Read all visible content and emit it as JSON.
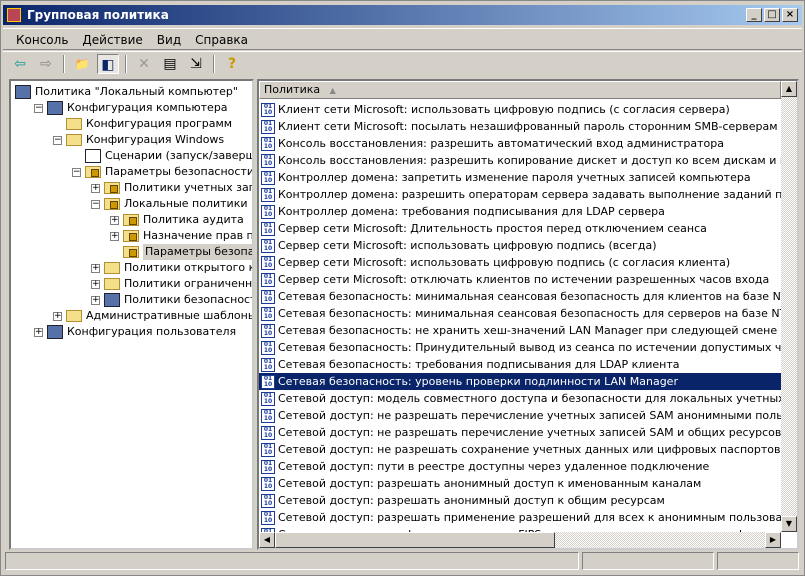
{
  "window": {
    "title": "Групповая политика",
    "controls": [
      "_",
      "□",
      "×"
    ]
  },
  "menu": [
    "Консоль",
    "Действие",
    "Вид",
    "Справка"
  ],
  "toolbar": [
    {
      "icon": "back-arrow-icon",
      "glyph": "⇦"
    },
    {
      "icon": "forward-arrow-icon",
      "glyph": "⇨"
    },
    {
      "icon": "up-folder-icon",
      "glyph": "📁"
    },
    {
      "icon": "show-hide-tree-icon",
      "glyph": "◧"
    },
    {
      "icon": "delete-icon",
      "glyph": "✕"
    },
    {
      "icon": "properties-icon",
      "glyph": "▤"
    },
    {
      "icon": "export-list-icon",
      "glyph": "⇲"
    },
    {
      "icon": "help-icon",
      "glyph": "?"
    }
  ],
  "tree": [
    {
      "label": "Политика \"Локальный компьютер\"",
      "level": 0,
      "icon": "policy",
      "toggle": ""
    },
    {
      "label": "Конфигурация компьютера",
      "level": 1,
      "icon": "computer",
      "toggle": "-"
    },
    {
      "label": "Конфигурация программ",
      "level": 2,
      "icon": "folder",
      "toggle": ""
    },
    {
      "label": "Конфигурация Windows",
      "level": 2,
      "icon": "folder",
      "toggle": "-"
    },
    {
      "label": "Сценарии (запуск/завершение)",
      "level": 3,
      "icon": "script",
      "toggle": ""
    },
    {
      "label": "Параметры безопасности",
      "level": 3,
      "icon": "lockfolder",
      "toggle": "-"
    },
    {
      "label": "Политики учетных записей",
      "level": 4,
      "icon": "lockfolder",
      "toggle": "+"
    },
    {
      "label": "Локальные политики",
      "level": 4,
      "icon": "lockfolder",
      "toggle": "-"
    },
    {
      "label": "Политика аудита",
      "level": 5,
      "icon": "lockfolder",
      "toggle": "+"
    },
    {
      "label": "Назначение прав пользователя",
      "level": 5,
      "icon": "lockfolder",
      "toggle": "+"
    },
    {
      "label": "Параметры безопасности",
      "level": 5,
      "icon": "lockfolder",
      "toggle": "",
      "selected": true
    },
    {
      "label": "Политики открытого ключа",
      "level": 4,
      "icon": "folder",
      "toggle": "+"
    },
    {
      "label": "Политики ограниченного использования программ",
      "level": 4,
      "icon": "folder",
      "toggle": "+"
    },
    {
      "label": "Политики безопасности IP на \"Локальный компьютер\"",
      "level": 4,
      "icon": "computer",
      "toggle": "+"
    },
    {
      "label": "Административные шаблоны",
      "level": 2,
      "icon": "folder",
      "toggle": "+"
    },
    {
      "label": "Конфигурация пользователя",
      "level": 1,
      "icon": "user",
      "toggle": "+"
    }
  ],
  "list": {
    "column": "Политика",
    "sort_indicator": "▲",
    "selected_index": 16,
    "rows": [
      "Клиент сети Microsoft: использовать цифровую подпись (с согласия сервера)",
      "Клиент сети Microsoft: посылать незашифрованный пароль сторонним SMB-серверам",
      "Консоль восстановления: разрешить автоматический вход администратора",
      "Консоль восстановления: разрешить копирование дискет и доступ ко всем дискам и папкам",
      "Контроллер домена: запретить изменение пароля учетных записей компьютера",
      "Контроллер домена: разрешить операторам сервера задавать выполнение заданий по расписанию",
      "Контроллер домена: требования подписывания для LDAP сервера",
      "Сервер сети Microsoft: Длительность простоя перед отключением сеанса",
      "Сервер сети Microsoft: использовать цифровую подпись (всегда)",
      "Сервер сети Microsoft: использовать цифровую подпись (с согласия клиента)",
      "Сервер сети Microsoft: отключать клиентов по истечении разрешенных часов входа",
      "Сетевая безопасность: минимальная сеансовая безопасность для клиентов на базе NTLM SSP (включая безопасный RPC)",
      "Сетевая безопасность: минимальная сеансовая безопасность для серверов на базе NTLM SSP (включая безопасный RPC)",
      "Сетевая безопасность: не хранить хеш-значений LAN Manager при следующей смене пароля",
      "Сетевая безопасность: Принудительный вывод из сеанса по истечении допустимых часов работы",
      "Сетевая безопасность: требования подписывания для LDAP клиента",
      "Сетевая безопасность: уровень проверки подлинности LAN Manager",
      "Сетевой доступ: модель совместного доступа и безопасности для локальных учетных записей",
      "Сетевой доступ: не разрешать перечисление учетных записей SAM анонимными пользователями",
      "Сетевой доступ: не разрешать перечисление учетных записей SAM и общих ресурсов анонимными пользователями",
      "Сетевой доступ: не разрешать сохранение учетных данных или цифровых паспортов .NET для сетевой проверки подлинности",
      "Сетевой доступ: пути в реестре доступны через удаленное подключение",
      "Сетевой доступ: разрешать анонимный доступ к именованным каналам",
      "Сетевой доступ: разрешать анонимный доступ к общим ресурсам",
      "Сетевой доступ: разрешать применение разрешений для всех к анонимным пользователям",
      "Системная криптография: использовать FIPS-совместимые алгоритмы для шифрования, хеширования и подписывания"
    ]
  },
  "colors": {
    "title_start": "#0a246a",
    "title_end": "#a6caf0",
    "selection": "#0a246a",
    "face": "#d4d0c8"
  }
}
